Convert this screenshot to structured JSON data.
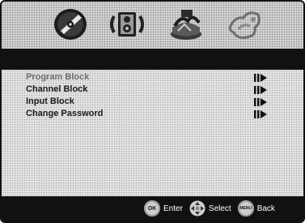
{
  "tabs": [
    {
      "name": "disc-icon"
    },
    {
      "name": "audio-icon"
    },
    {
      "name": "parental-icon"
    },
    {
      "name": "settings-icon"
    }
  ],
  "title_bar": {
    "label": ""
  },
  "menu": {
    "items": [
      {
        "label": "Program Block",
        "selected": true
      },
      {
        "label": "Channel Block",
        "selected": false
      },
      {
        "label": "Input Block",
        "selected": false
      },
      {
        "label": "Change Password",
        "selected": false
      }
    ]
  },
  "footer": {
    "ok_key": "OK",
    "enter_label": "Enter",
    "select_label": "Select",
    "menu_key": "MENU",
    "back_label": "Back"
  },
  "colors": {
    "frame": "#111111",
    "bar": "#111111",
    "text": "#1a1a1a",
    "selected_text": "#6d6d6d"
  }
}
